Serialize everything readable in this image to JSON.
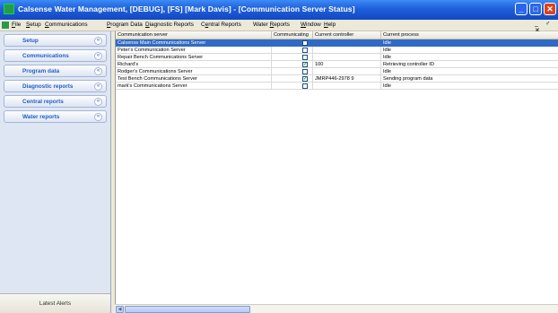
{
  "window": {
    "title": "Calsense Water Management, [DEBUG], [FS]   [Mark Davis] - [Communication Server Status]",
    "min_glyph": "_",
    "max_glyph": "□",
    "close_glyph": "✕"
  },
  "menubar": {
    "items": [
      {
        "label": "File",
        "key": "F"
      },
      {
        "label": "Setup",
        "key": "S"
      },
      {
        "label": "Communications",
        "key": "C"
      },
      {
        "label": "Program Data",
        "key": "P"
      },
      {
        "label": "Diagnostic Reports",
        "key": "D"
      },
      {
        "label": "Central Reports",
        "key": "e"
      },
      {
        "label": "Water Reports",
        "key": "R"
      },
      {
        "label": "Window",
        "key": "W"
      },
      {
        "label": "Help",
        "key": "H"
      }
    ],
    "mdi_controls": "_ ♂ ✕"
  },
  "sidebar": {
    "items": [
      {
        "label": "Setup"
      },
      {
        "label": "Communications"
      },
      {
        "label": "Program data"
      },
      {
        "label": "Diagnostic reports"
      },
      {
        "label": "Central reports"
      },
      {
        "label": "Water reports"
      }
    ],
    "chevron_glyph": "«",
    "alerts_label": "Latest Alerts"
  },
  "table": {
    "columns": [
      {
        "label": "Communication server"
      },
      {
        "label": "Communicating"
      },
      {
        "label": "Current controller"
      },
      {
        "label": "Current process"
      }
    ],
    "rows": [
      {
        "server": "Calsense Main Communications Server",
        "communicating": false,
        "controller": "",
        "process": "Idle",
        "selected": true
      },
      {
        "server": "Peter's Communication Server",
        "communicating": false,
        "controller": "",
        "process": "Idle",
        "selected": false
      },
      {
        "server": "Repair Bench Communications Server",
        "communicating": false,
        "controller": "",
        "process": "Idle",
        "selected": false
      },
      {
        "server": "Richard's",
        "communicating": true,
        "controller": "100",
        "process": "Retrieving controller ID",
        "selected": false
      },
      {
        "server": "Rodger's Communications Server",
        "communicating": false,
        "controller": "",
        "process": "Idle",
        "selected": false
      },
      {
        "server": "Test Bench Communications Server",
        "communicating": true,
        "controller": "JMRP446-2978 9",
        "process": "Sending program data",
        "selected": false
      },
      {
        "server": "mark's Communications Server",
        "communicating": false,
        "controller": "",
        "process": "Idle",
        "selected": false
      }
    ],
    "check_glyph": "✓"
  },
  "scrollbar": {
    "left_arrow_glyph": "◀"
  },
  "colors": {
    "titlebar": "#1f5fd8",
    "selection": "#316ac5",
    "sidebar_text": "#215dc6",
    "check": "#21a121"
  }
}
